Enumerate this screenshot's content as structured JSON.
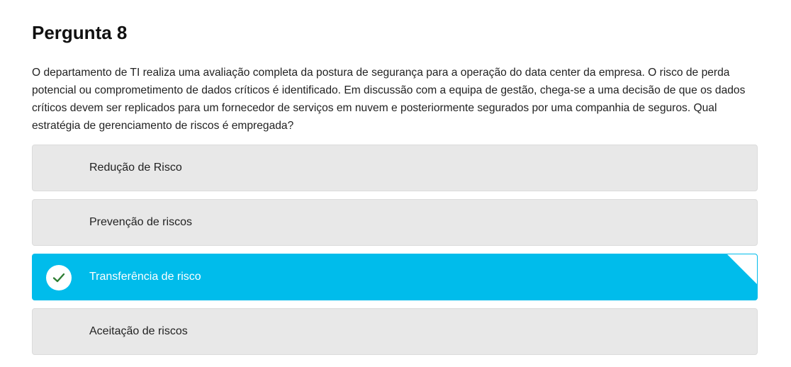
{
  "question": {
    "title": "Pergunta 8",
    "text": "O departamento de TI realiza uma avaliação completa da postura de segurança para a operação do data center da empresa. O risco de perda potencial ou comprometimento de dados críticos é identificado. Em discussão com a equipa de gestão, chega-se a uma decisão de que os dados críticos devem ser replicados para um fornecedor de serviços em nuvem e posteriormente segurados por uma companhia de seguros. Qual estratégia de gerenciamento de riscos é empregada?"
  },
  "options": [
    {
      "label": "Redução de Risco",
      "selected": false
    },
    {
      "label": "Prevenção de riscos",
      "selected": false
    },
    {
      "label": "Transferência de risco",
      "selected": true,
      "icon": "check-icon"
    },
    {
      "label": "Aceitação de riscos",
      "selected": false
    }
  ],
  "colors": {
    "selected_bg": "#00bceb",
    "option_bg": "#e8e8e8",
    "check_mark": "#2e7d32"
  }
}
